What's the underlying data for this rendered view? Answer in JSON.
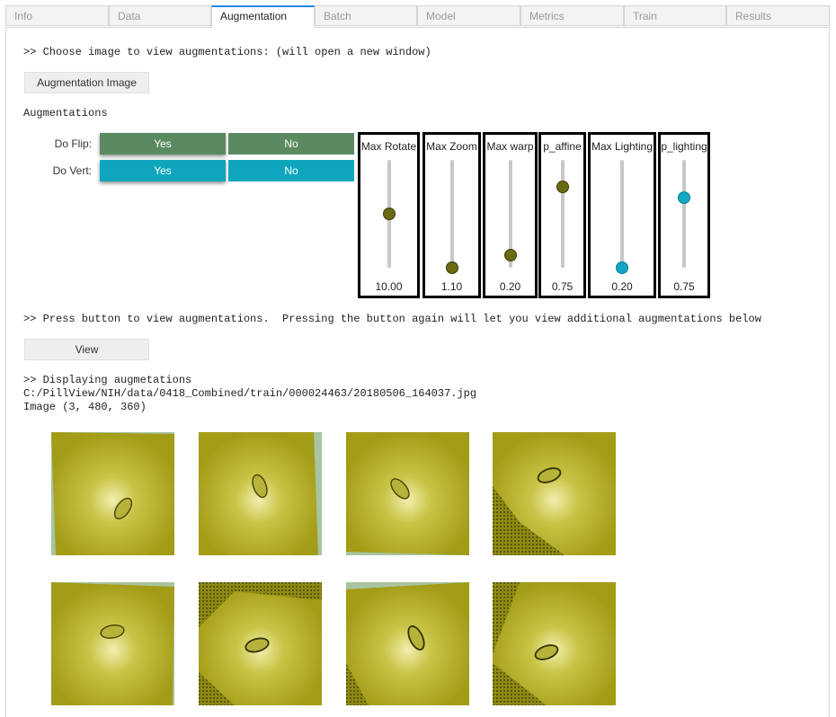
{
  "tabs": [
    {
      "label": "Info"
    },
    {
      "label": "Data"
    },
    {
      "label": "Augmentation"
    },
    {
      "label": "Batch"
    },
    {
      "label": "Model"
    },
    {
      "label": "Metrics"
    },
    {
      "label": "Train"
    },
    {
      "label": "Results"
    }
  ],
  "active_tab": "Augmentation",
  "choose_text": ">> Choose image to view augmentations: (will open a new window)",
  "aug_image_button": "Augmentation Image",
  "augmentations_heading": "Augmentations",
  "do_flip": {
    "label": "Do Flip:",
    "yes": "Yes",
    "no": "No",
    "selected": "Yes"
  },
  "do_vert": {
    "label": "Do Vert:",
    "yes": "Yes",
    "no": "No",
    "selected": "Yes"
  },
  "sliders": [
    {
      "label": "Max Rotate",
      "value": "10.00",
      "level": 0.5
    },
    {
      "label": "Max Zoom",
      "value": "1.10",
      "level": 0.0
    },
    {
      "label": "Max warp",
      "value": "0.20",
      "level": 0.12
    },
    {
      "label": "p_affine",
      "value": "0.75",
      "level": 0.75
    },
    {
      "label": "Max Lighting",
      "value": "0.20",
      "level": 0.0
    },
    {
      "label": "p_lighting",
      "value": "0.75",
      "level": 0.65
    }
  ],
  "press_text": ">> Press button to view augmentations.  Pressing the button again will let you view additional augmentations below",
  "view_button": "View",
  "display_text": ">> Displaying augmetations",
  "image_path": "C:/PillView/NIH/data/0418_Combined/train/000024463/20180506_164037.jpg",
  "image_shape": "Image (3, 480, 360)",
  "colors": {
    "flip": "#5b8a61",
    "vert": "#0fa6bd",
    "thumb": "#a8a41c",
    "knob_olive": "#6b6b12",
    "knob_cyan": "#14a7c4"
  }
}
